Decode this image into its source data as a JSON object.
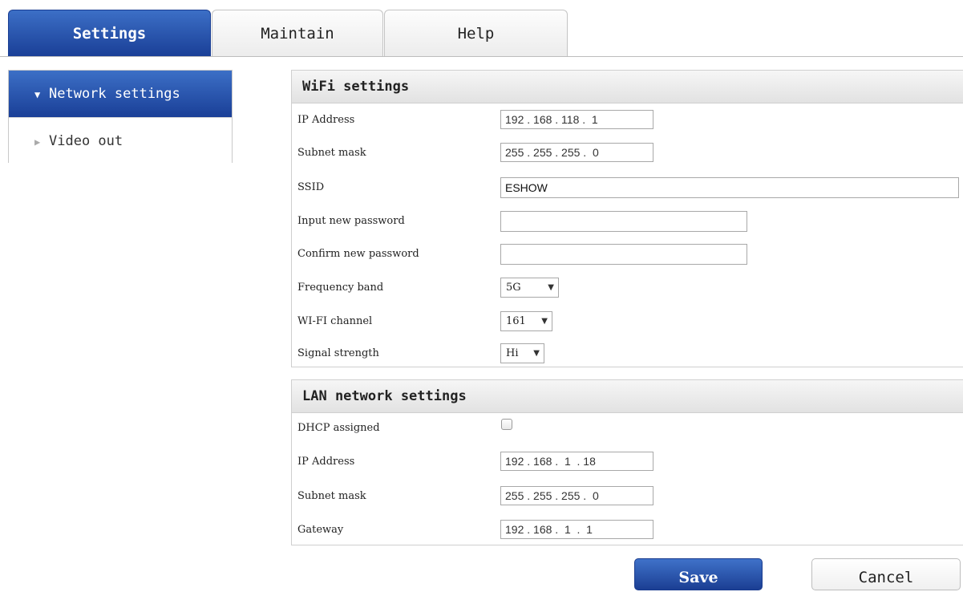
{
  "tabs": [
    {
      "label": "Settings",
      "active": true
    },
    {
      "label": "Maintain",
      "active": false
    },
    {
      "label": "Help",
      "active": false
    }
  ],
  "sidebar": {
    "items": [
      {
        "label": "Network settings",
        "icon": "triangle-down-icon",
        "active": true
      },
      {
        "label": "Video out",
        "icon": "triangle-right-icon",
        "active": false
      }
    ]
  },
  "wifi": {
    "title": "WiFi settings",
    "ip_label": "IP Address",
    "ip_value": "192 . 168 . 118 .  1",
    "subnet_label": "Subnet mask",
    "subnet_value": "255 . 255 . 255 .  0",
    "ssid_label": "SSID",
    "ssid_value": "ESHOW",
    "newpw_label": "Input new password",
    "newpw_value": "",
    "confirmpw_label": "Confirm new password",
    "confirmpw_value": "",
    "band_label": "Frequency band",
    "band_value": "5G",
    "channel_label": "WI-FI channel",
    "channel_value": "161",
    "strength_label": "Signal strength",
    "strength_value": "Hi"
  },
  "lan": {
    "title": "LAN network settings",
    "dhcp_label": "DHCP assigned",
    "dhcp_checked": false,
    "ip_label": "IP Address",
    "ip_value": "192 . 168 .  1  . 18",
    "subnet_label": "Subnet mask",
    "subnet_value": "255 . 255 . 255 .  0",
    "gateway_label": "Gateway",
    "gateway_value": "192 . 168 .  1  .  1"
  },
  "buttons": {
    "save_label": "Save",
    "cancel_label": "Cancel"
  },
  "colors": {
    "accent_blue_top": "#3c6fc6",
    "accent_blue_bottom": "#1a3f97"
  }
}
